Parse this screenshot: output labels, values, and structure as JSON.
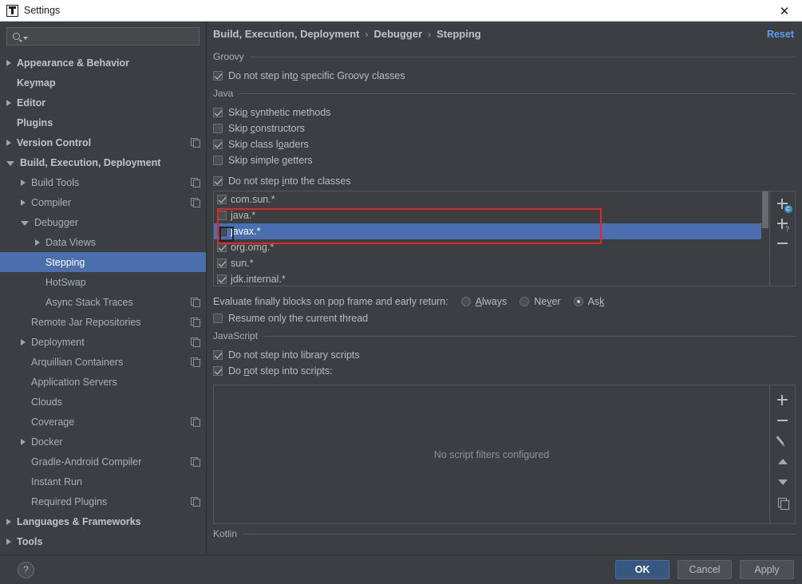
{
  "window": {
    "title": "Settings",
    "logo_icon": "intellij-idea-logo",
    "close_icon": "close-icon",
    "close_label": "✕"
  },
  "search": {
    "placeholder": "",
    "value": "",
    "icon": "search-icon",
    "dropdown_icon": "chevron-down-icon"
  },
  "sidebar": {
    "items": [
      {
        "label": "Appearance & Behavior",
        "level": 0,
        "arrow": "right",
        "copy": false,
        "selected": false
      },
      {
        "label": "Keymap",
        "level": 0,
        "arrow": "none",
        "copy": false,
        "selected": false
      },
      {
        "label": "Editor",
        "level": 0,
        "arrow": "right",
        "copy": false,
        "selected": false
      },
      {
        "label": "Plugins",
        "level": 0,
        "arrow": "none",
        "copy": false,
        "selected": false
      },
      {
        "label": "Version Control",
        "level": 0,
        "arrow": "right",
        "copy": true,
        "selected": false
      },
      {
        "label": "Build, Execution, Deployment",
        "level": 0,
        "arrow": "down",
        "copy": false,
        "selected": false
      },
      {
        "label": "Build Tools",
        "level": 1,
        "arrow": "right",
        "copy": true,
        "selected": false
      },
      {
        "label": "Compiler",
        "level": 1,
        "arrow": "right",
        "copy": true,
        "selected": false
      },
      {
        "label": "Debugger",
        "level": 1,
        "arrow": "down",
        "copy": false,
        "selected": false
      },
      {
        "label": "Data Views",
        "level": 2,
        "arrow": "right",
        "copy": false,
        "selected": false
      },
      {
        "label": "Stepping",
        "level": 2,
        "arrow": "none",
        "copy": false,
        "selected": true
      },
      {
        "label": "HotSwap",
        "level": 2,
        "arrow": "none",
        "copy": false,
        "selected": false
      },
      {
        "label": "Async Stack Traces",
        "level": 2,
        "arrow": "none",
        "copy": true,
        "selected": false
      },
      {
        "label": "Remote Jar Repositories",
        "level": 1,
        "arrow": "none",
        "copy": true,
        "selected": false
      },
      {
        "label": "Deployment",
        "level": 1,
        "arrow": "right",
        "copy": true,
        "selected": false
      },
      {
        "label": "Arquillian Containers",
        "level": 1,
        "arrow": "none",
        "copy": true,
        "selected": false
      },
      {
        "label": "Application Servers",
        "level": 1,
        "arrow": "none",
        "copy": false,
        "selected": false
      },
      {
        "label": "Clouds",
        "level": 1,
        "arrow": "none",
        "copy": false,
        "selected": false
      },
      {
        "label": "Coverage",
        "level": 1,
        "arrow": "none",
        "copy": true,
        "selected": false
      },
      {
        "label": "Docker",
        "level": 1,
        "arrow": "right",
        "copy": false,
        "selected": false
      },
      {
        "label": "Gradle-Android Compiler",
        "level": 1,
        "arrow": "none",
        "copy": true,
        "selected": false
      },
      {
        "label": "Instant Run",
        "level": 1,
        "arrow": "none",
        "copy": false,
        "selected": false
      },
      {
        "label": "Required Plugins",
        "level": 1,
        "arrow": "none",
        "copy": true,
        "selected": false
      },
      {
        "label": "Languages & Frameworks",
        "level": 0,
        "arrow": "right",
        "copy": false,
        "selected": false
      },
      {
        "label": "Tools",
        "level": 0,
        "arrow": "right",
        "copy": false,
        "selected": false
      }
    ]
  },
  "breadcrumb": {
    "parts": [
      "Build, Execution, Deployment",
      "Debugger",
      "Stepping"
    ],
    "separator": "›",
    "reset_label": "Reset"
  },
  "sections": {
    "groovy": {
      "title": "Groovy",
      "checkboxes": [
        {
          "label": "Do not step into specific Groovy classes",
          "checked": true,
          "mnemonic_index": 15
        }
      ]
    },
    "java": {
      "title": "Java",
      "checkboxes": [
        {
          "label": "Skip synthetic methods",
          "checked": true,
          "mnemonic_index": 3
        },
        {
          "label": "Skip constructors",
          "checked": false,
          "mnemonic_index": 5
        },
        {
          "label": "Skip class loaders",
          "checked": true,
          "mnemonic_index": 12
        },
        {
          "label": "Skip simple getters",
          "checked": false,
          "mnemonic_index": 12
        }
      ],
      "classes_checkbox": {
        "label": "Do not step into the classes",
        "checked": true,
        "mnemonic_index": 12
      },
      "class_filters": [
        {
          "pattern": "com.sun.*",
          "checked": true,
          "selected": false
        },
        {
          "pattern": "java.*",
          "checked": false,
          "selected": false
        },
        {
          "pattern": "javax.*",
          "checked": false,
          "selected": true
        },
        {
          "pattern": "org.omg.*",
          "checked": true,
          "selected": false
        },
        {
          "pattern": "sun.*",
          "checked": true,
          "selected": false
        },
        {
          "pattern": "jdk.internal.*",
          "checked": true,
          "selected": false
        }
      ],
      "filter_buttons": [
        {
          "name": "add-class-filter-button",
          "icon": "plus-icon",
          "badge": "C"
        },
        {
          "name": "add-pattern-filter-button",
          "icon": "plus-icon",
          "badge": "?"
        },
        {
          "name": "remove-filter-button",
          "icon": "minus-icon",
          "badge": ""
        }
      ],
      "evaluate_label": "Evaluate finally blocks on pop frame and early return:",
      "evaluate_options": [
        {
          "label": "Always",
          "selected": false,
          "mnemonic_index": 0
        },
        {
          "label": "Never",
          "selected": false,
          "mnemonic_index": 2
        },
        {
          "label": "Ask",
          "selected": true,
          "mnemonic_index": 2
        }
      ],
      "resume_checkbox": {
        "label": "Resume only the current thread",
        "checked": false,
        "mnemonic_index": -1
      }
    },
    "javascript": {
      "title": "JavaScript",
      "checkboxes": [
        {
          "label": "Do not step into library scripts",
          "checked": true,
          "mnemonic_index": -1
        },
        {
          "label": "Do not step into scripts:",
          "checked": true,
          "mnemonic_index": 3
        }
      ],
      "empty_text": "No script filters configured",
      "panel_buttons": [
        {
          "name": "add-script-filter-button",
          "icon": "plus-icon"
        },
        {
          "name": "remove-script-filter-button",
          "icon": "minus-icon"
        },
        {
          "name": "edit-script-filter-button",
          "icon": "pencil-icon"
        },
        {
          "name": "move-up-button",
          "icon": "arrow-up-icon"
        },
        {
          "name": "move-down-button",
          "icon": "arrow-down-icon"
        },
        {
          "name": "copy-script-filter-button",
          "icon": "copy-icon"
        }
      ]
    },
    "kotlin": {
      "title": "Kotlin"
    }
  },
  "footer": {
    "help_label": "?",
    "buttons": [
      {
        "label": "OK",
        "primary": true
      },
      {
        "label": "Cancel",
        "primary": false
      },
      {
        "label": "Apply",
        "primary": false
      }
    ]
  },
  "colors": {
    "background": "#3c3f41",
    "selection": "#4b6eaf",
    "accent_link": "#589df6",
    "primary_button": "#365880",
    "annotation_red": "#ee2222",
    "badge_blue": "#3592c4"
  }
}
